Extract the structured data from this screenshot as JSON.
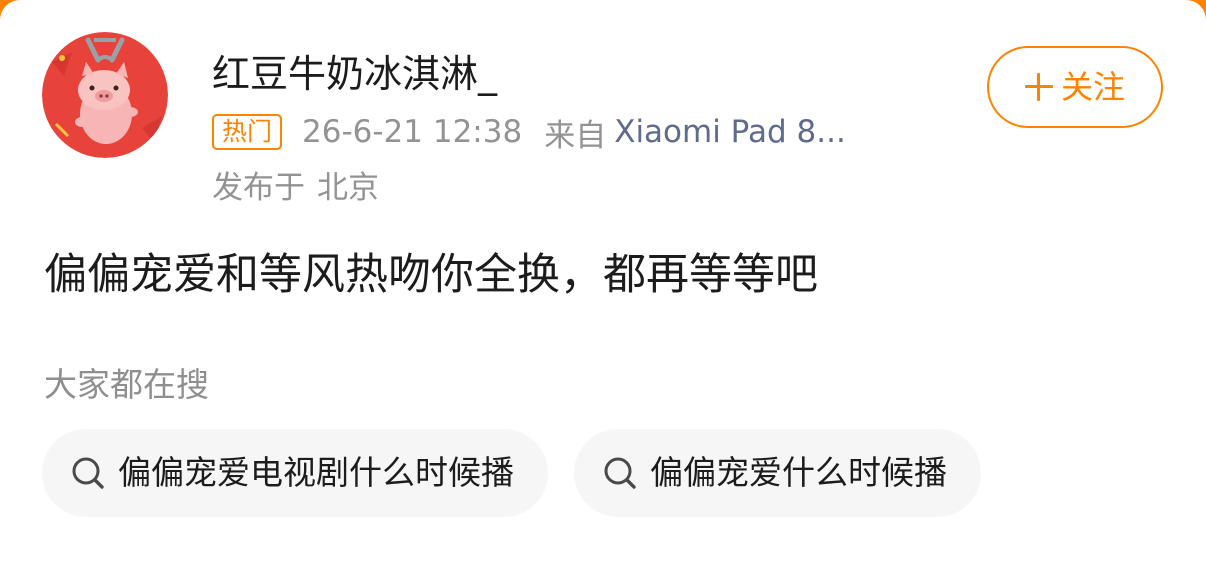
{
  "post": {
    "author": {
      "name": "红豆牛奶冰淇淋_",
      "avatar": "pink-pig-avatar"
    },
    "hot_tag": "热门",
    "time": "26-6-21 12:38",
    "source_prefix": "来自",
    "source_device": "Xiaomi Pad 8...",
    "location_prefix": "发布于",
    "location_city": "北京",
    "follow_button": {
      "icon": "plus-icon",
      "label": "关注"
    },
    "body_text": "偏偏宠爱和等风热吻你全换，都再等等吧"
  },
  "search": {
    "heading": "大家都在搜",
    "chips": [
      {
        "icon": "search-icon",
        "label": "偏偏宠爱电视剧什么时候播"
      },
      {
        "icon": "search-icon",
        "label": "偏偏宠爱什么时候播"
      }
    ]
  },
  "colors": {
    "accent": "#ff8200",
    "text_primary": "#1c1c1c",
    "text_secondary": "#939393",
    "link_device": "#5e6b8c",
    "chip_bg": "#f6f6f6",
    "avatar_bg": "#e8433a"
  }
}
